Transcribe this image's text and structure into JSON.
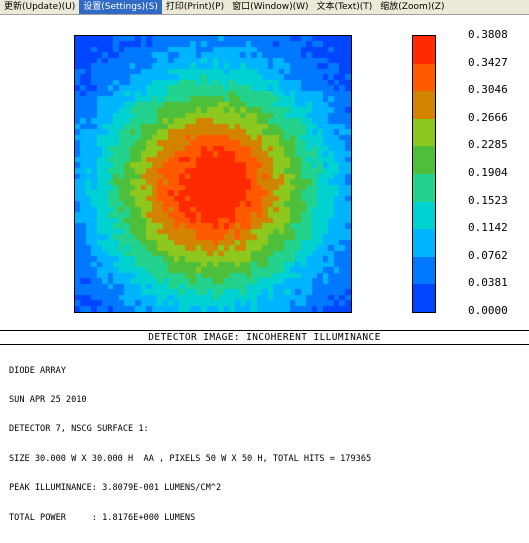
{
  "menu": {
    "items": [
      {
        "label": "更新(Update)(U)"
      },
      {
        "label": "设置(Settings)(S)"
      },
      {
        "label": "打印(Print)(P)"
      },
      {
        "label": "窗口(Window)(W)"
      },
      {
        "label": "文本(Text)(T)"
      },
      {
        "label": "缩放(Zoom)(Z)"
      }
    ]
  },
  "chart_data": {
    "type": "heatmap",
    "grid": {
      "cols": 50,
      "rows": 50
    },
    "colorbar": {
      "ticks": [
        "0.3808",
        "0.3427",
        "0.3046",
        "0.2666",
        "0.2285",
        "0.1904",
        "0.1523",
        "0.1142",
        "0.0762",
        "0.0381",
        "0.0000"
      ],
      "colors": [
        "#ff2a00",
        "#ff5a00",
        "#d28400",
        "#8dc81e",
        "#4ebf3a",
        "#23d28c",
        "#00d2d2",
        "#00b4ff",
        "#0078ff",
        "#0046ff"
      ],
      "range": [
        0.0,
        0.3808
      ]
    },
    "peak": 0.38079,
    "title": "DETECTOR IMAGE: INCOHERENT ILLUMINANCE"
  },
  "info": {
    "lines": [
      "DIODE ARRAY",
      "SUN APR 25 2010",
      "DETECTOR 7, NSCG SURFACE 1:",
      "SIZE 30.000 W X 30.000 H  AA , PIXELS 50 W X 50 H, TOTAL HITS = 179365",
      "PEAK ILLUMINANCE: 3.8079E-001 LUMENS/CM^2",
      "TOTAL POWER     : 1.8176E+000 LUMENS"
    ]
  }
}
